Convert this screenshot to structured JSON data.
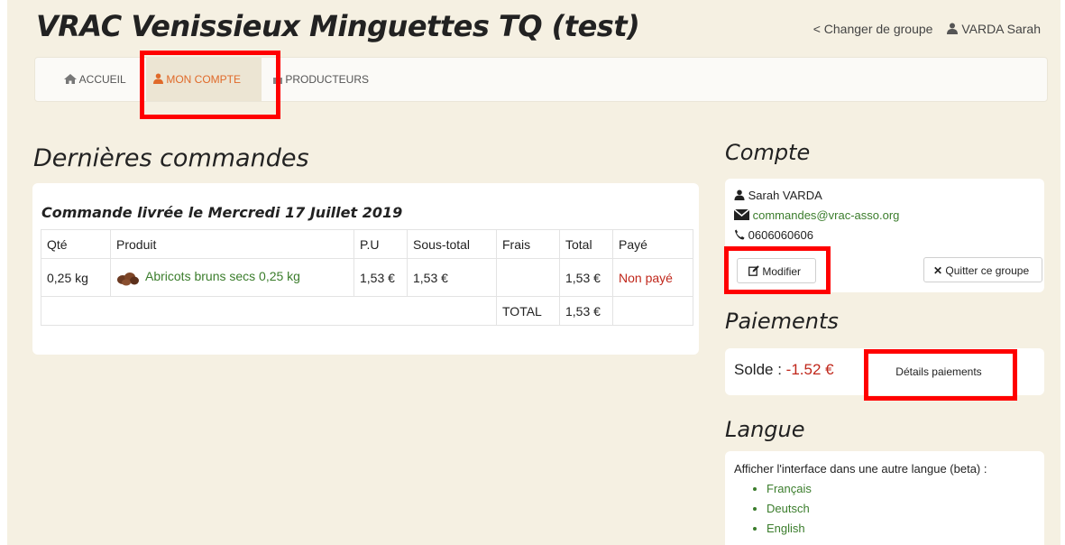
{
  "header": {
    "title": "VRAC Venissieux Minguettes TQ (test)",
    "change_group": "< Changer de groupe",
    "user_name": "VARDA Sarah"
  },
  "nav": {
    "items": [
      {
        "label": "ACCUEIL",
        "icon": "home-icon"
      },
      {
        "label": "MON COMPTE",
        "icon": "user-icon"
      },
      {
        "label": "PRODUCTEURS",
        "icon": "store-icon"
      }
    ]
  },
  "orders": {
    "heading": "Dernières commandes",
    "order_title": "Commande livrée le Mercredi 17 Juillet 2019",
    "columns": [
      "Qté",
      "Produit",
      "P.U",
      "Sous-total",
      "Frais",
      "Total",
      "Payé"
    ],
    "rows": [
      {
        "qty": "0,25 kg",
        "product": "Abricots bruns secs 0,25 kg",
        "pu": "1,53 €",
        "subtotal": "1,53 €",
        "fees": "",
        "total": "1,53 €",
        "paid": "Non payé"
      }
    ],
    "total_label": "TOTAL",
    "total_value": "1,53 €"
  },
  "account": {
    "heading": "Compte",
    "name": "Sarah VARDA",
    "email": "commandes@vrac-asso.org",
    "phone": "0606060606",
    "edit_label": "Modifier",
    "leave_label": "Quitter ce groupe"
  },
  "payments": {
    "heading": "Paiements",
    "balance_label": "Solde : ",
    "balance_value": "-1.52 €",
    "details_label": "Détails paiements"
  },
  "language": {
    "heading": "Langue",
    "prompt": "Afficher l'interface dans une autre langue (beta) :",
    "options": [
      "Français",
      "Deutsch",
      "English"
    ]
  },
  "colors": {
    "accent_orange": "#e06a2a",
    "link_green": "#3b7d2c",
    "unpaid_red": "#c0271b",
    "highlight_red": "#ff0000",
    "page_bg": "#f5f0e2"
  }
}
